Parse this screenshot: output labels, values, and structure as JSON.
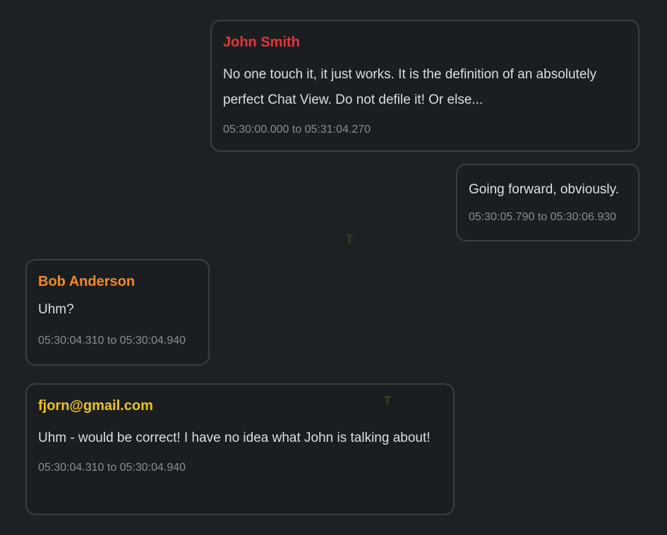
{
  "messages": [
    {
      "sender": "John Smith",
      "sender_color": "#e5343a",
      "text": "No one touch it, it just works. It is the definition of an absolutely perfect Chat View. Do not defile it! Or else...",
      "time": "05:30:00.000 to 05:31:04.270",
      "align": "right"
    },
    {
      "sender": "",
      "text": "Going forward, obviously.",
      "time": "05:30:05.790 to 05:30:06.930",
      "align": "right"
    },
    {
      "sender": "Bob Anderson",
      "sender_color": "#f08a24",
      "text": "Uhm?",
      "time": "05:30:04.310 to 05:30:04.940",
      "align": "left"
    },
    {
      "sender": "fjorn@gmail.com",
      "sender_color": "#f0c21b",
      "text": "Uhm - would be correct! I have no idea what John is talking about!",
      "time": "05:30:04.310 to 05:30:04.940",
      "align": "left"
    }
  ]
}
